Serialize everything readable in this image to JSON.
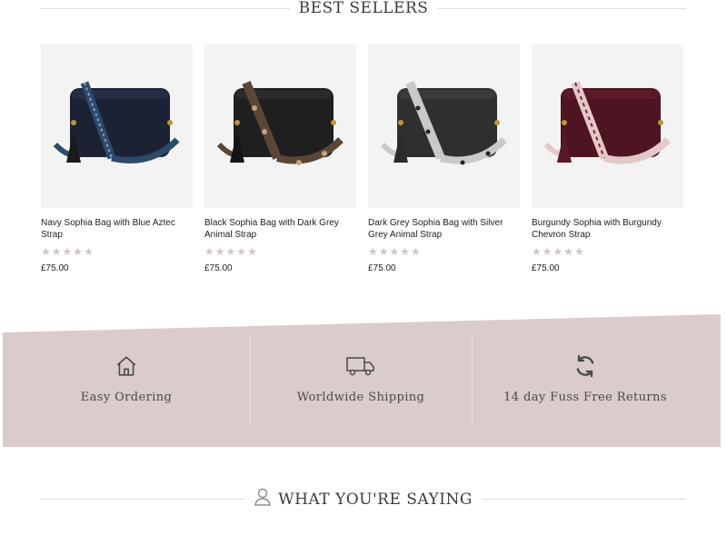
{
  "best_sellers": {
    "title": "BEST SELLERS"
  },
  "products": [
    {
      "name": "Navy Sophia Bag with Blue Aztec Strap",
      "price": "£75.00",
      "bag_color": "#1c2233",
      "strap": "aztec-blue"
    },
    {
      "name": "Black Sophia Bag with Dark Grey Animal Strap",
      "price": "£75.00",
      "bag_color": "#1f1f1f",
      "strap": "leopard-brown"
    },
    {
      "name": "Dark Grey Sophia Bag with Silver Grey Animal Strap",
      "price": "£75.00",
      "bag_color": "#2f2f2f",
      "strap": "leopard-grey"
    },
    {
      "name": "Burgundy Sophia with Burgundy Chevron Strap",
      "price": "£75.00",
      "bag_color": "#4e1421",
      "strap": "chevron-burgundy"
    }
  ],
  "rating_stars": 5,
  "features": [
    {
      "label": "Easy Ordering",
      "icon": "home-icon"
    },
    {
      "label": "Worldwide Shipping",
      "icon": "truck-icon"
    },
    {
      "label": "14 day Fuss Free Returns",
      "icon": "refresh-icon"
    }
  ],
  "testimonials": {
    "title": "WHAT YOU'RE SAYING",
    "icon": "user-icon"
  },
  "colors": {
    "band": "#d9cccb",
    "star": "#cfc6c6",
    "icon": "#4a4a4a"
  }
}
